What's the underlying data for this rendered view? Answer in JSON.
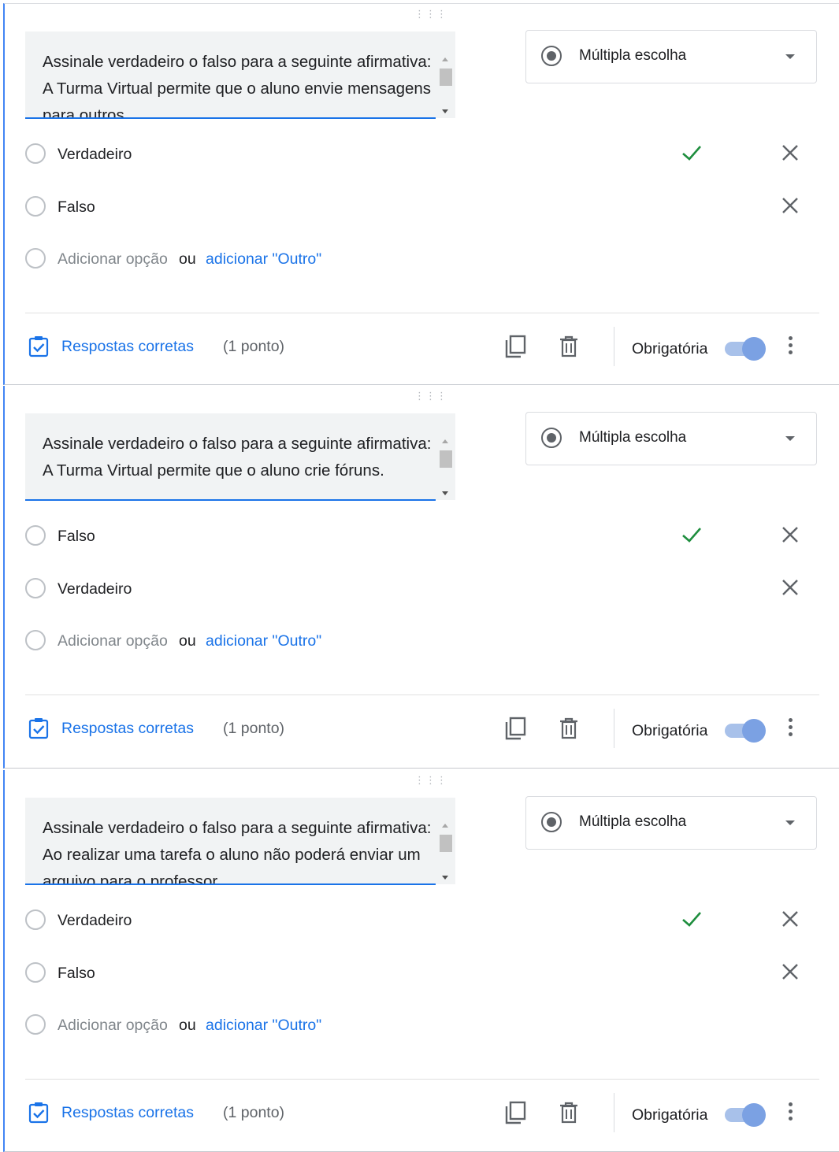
{
  "cards": [
    {
      "question": "Assinale verdadeiro o falso para a seguinte afirmativa: A Turma Virtual permite que o aluno envie mensagens para outros",
      "type_label": "Múltipla escolha",
      "options": [
        {
          "label": "Verdadeiro",
          "correct": true
        },
        {
          "label": "Falso",
          "correct": false
        }
      ],
      "add_option": "Adicionar opção",
      "or_word": "ou",
      "add_other": "adicionar \"Outro\"",
      "answer_key": "Respostas corretas",
      "points": "(1 ponto)",
      "required_label": "Obrigatória",
      "required_on": true
    },
    {
      "question": "Assinale verdadeiro o falso para a seguinte afirmativa: A Turma Virtual permite que o aluno crie fóruns.",
      "type_label": "Múltipla escolha",
      "options": [
        {
          "label": "Falso",
          "correct": true
        },
        {
          "label": "Verdadeiro",
          "correct": false
        }
      ],
      "add_option": "Adicionar opção",
      "or_word": "ou",
      "add_other": "adicionar \"Outro\"",
      "answer_key": "Respostas corretas",
      "points": "(1 ponto)",
      "required_label": "Obrigatória",
      "required_on": true
    },
    {
      "question": "Assinale verdadeiro o falso para a seguinte afirmativa: Ao realizar uma tarefa o aluno não poderá enviar um arquivo para o professor.",
      "type_label": "Múltipla escolha",
      "options": [
        {
          "label": "Verdadeiro",
          "correct": true
        },
        {
          "label": "Falso",
          "correct": false
        }
      ],
      "add_option": "Adicionar opção",
      "or_word": "ou",
      "add_other": "adicionar \"Outro\"",
      "answer_key": "Respostas corretas",
      "points": "(1 ponto)",
      "required_label": "Obrigatória",
      "required_on": true
    }
  ],
  "colors": {
    "accent": "#1a73e8",
    "correct_check": "#1e8e3e",
    "toggle_thumb": "#7ba1e3",
    "question_bg": "#f1f3f4"
  },
  "icons": {
    "drag": "drag-handle-icon",
    "check": "check-icon",
    "remove": "close-icon",
    "answer_key": "answer-key-icon",
    "duplicate": "copy-icon",
    "delete": "trash-icon",
    "more": "more-vert-icon"
  }
}
